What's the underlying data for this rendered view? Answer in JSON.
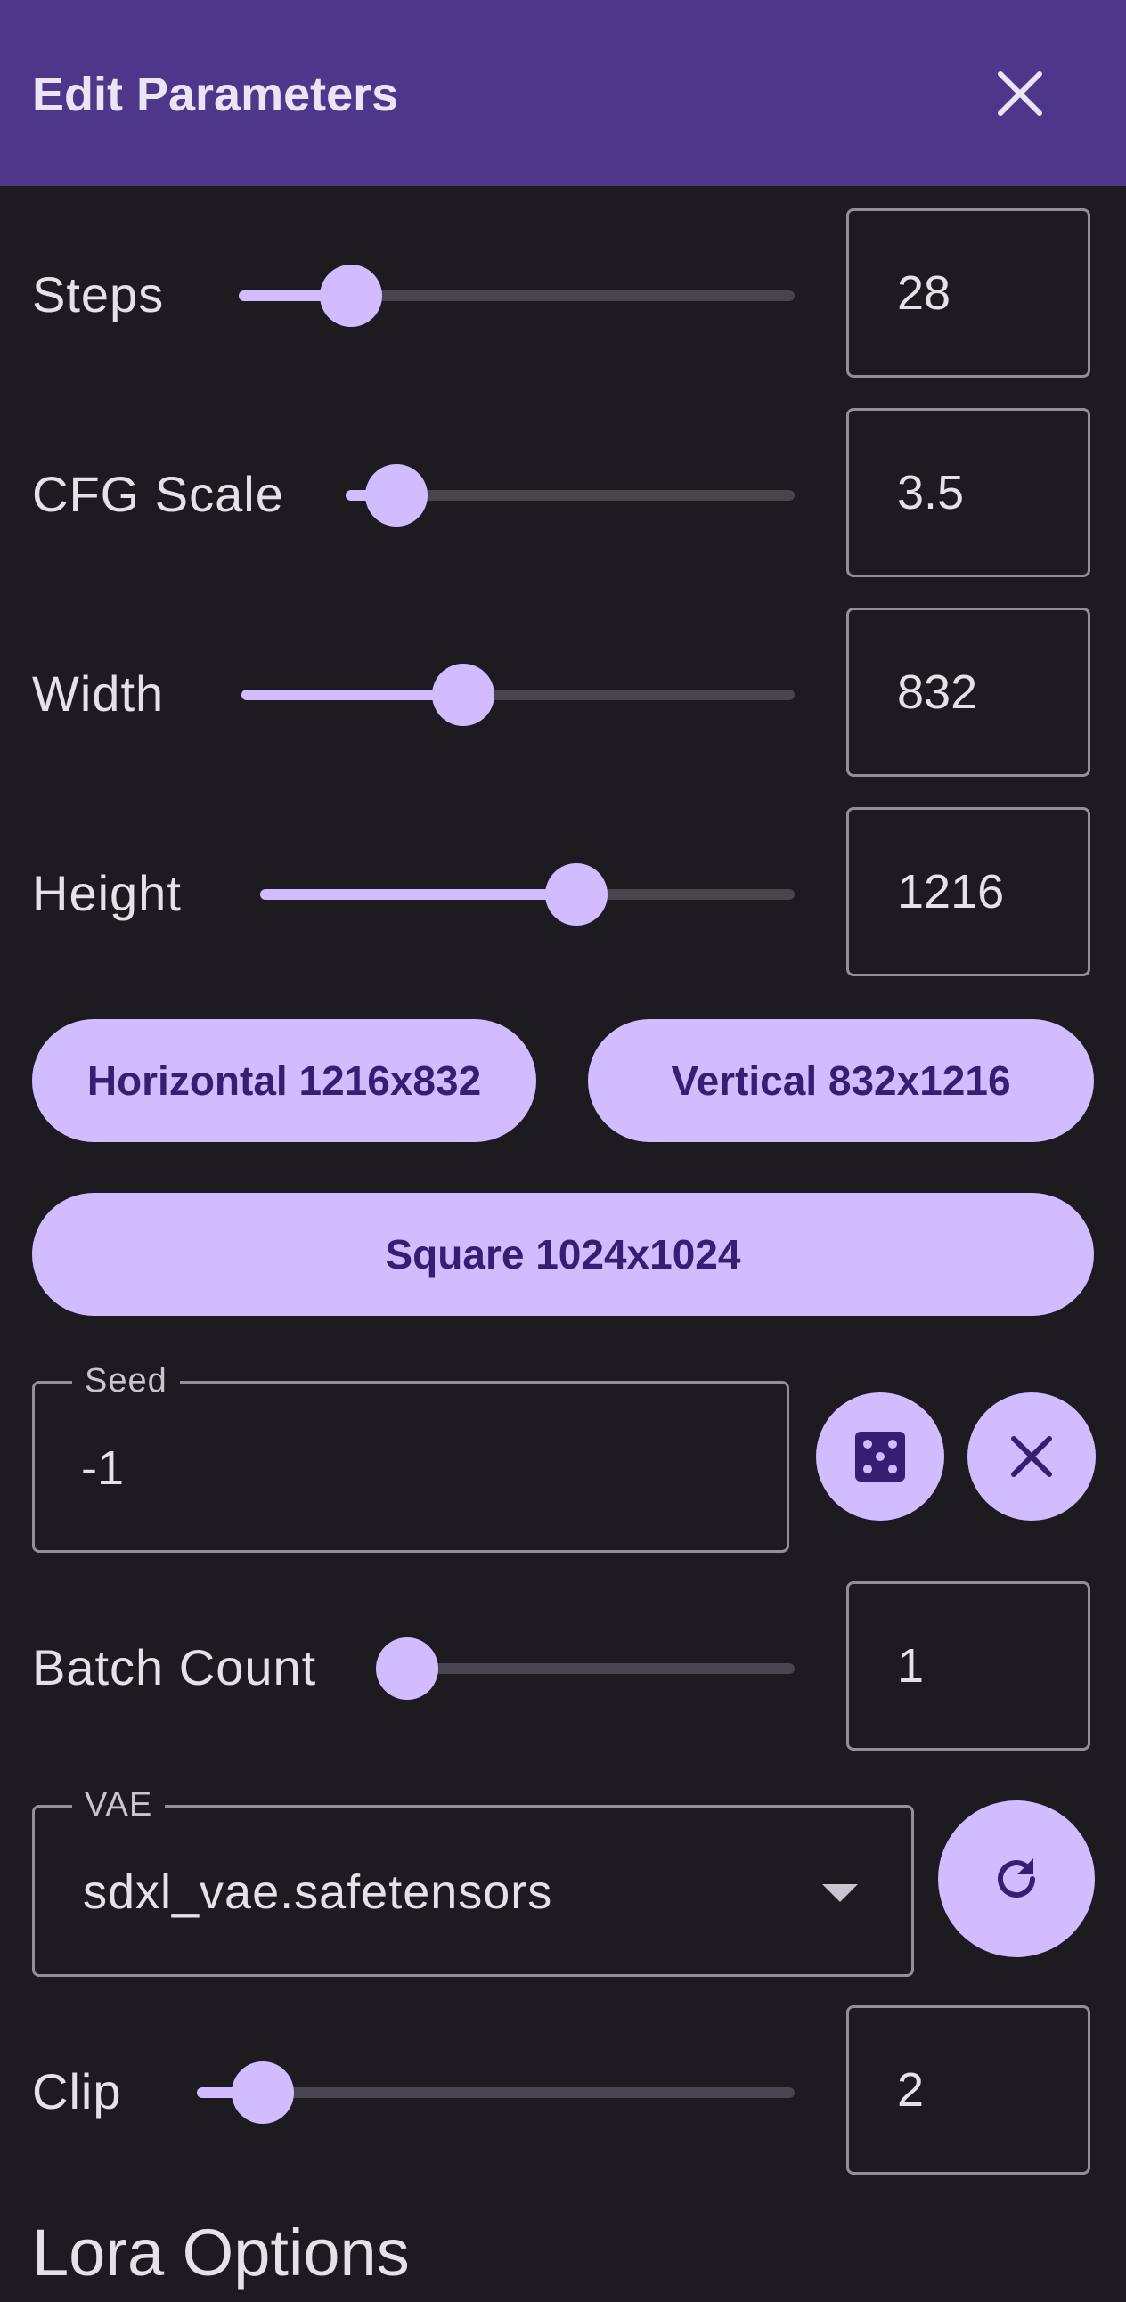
{
  "header": {
    "title": "Edit Parameters",
    "close_icon": "close-icon"
  },
  "steps": {
    "label": "Steps",
    "value": "28",
    "fraction": 0.19
  },
  "cfg_scale": {
    "label": "CFG Scale",
    "value": "3.5",
    "fraction": 0.1
  },
  "width": {
    "label": "Width",
    "value": "832",
    "fraction": 0.39
  },
  "height": {
    "label": "Height",
    "value": "1216",
    "fraction": 0.58
  },
  "presets": {
    "horizontal": "Horizontal 1216x832",
    "vertical": "Vertical 832x1216",
    "square": "Square 1024x1024"
  },
  "seed": {
    "label": "Seed",
    "value": "-1",
    "random_icon": "dice-icon",
    "clear_icon": "close-icon"
  },
  "batch_count": {
    "label": "Batch Count",
    "value": "1",
    "fraction": 0.0
  },
  "vae": {
    "label": "VAE",
    "value": "sdxl_vae.safetensors",
    "dropdown_icon": "dropdown-arrow-icon",
    "refresh_icon": "refresh-icon"
  },
  "clip": {
    "label": "Clip",
    "value": "2",
    "fraction": 0.1
  },
  "lora": {
    "title": "Lora Options"
  },
  "colors": {
    "accent": "#d0bcff",
    "header": "#4e378b",
    "background": "#1d1b20",
    "on_accent": "#381e72"
  }
}
